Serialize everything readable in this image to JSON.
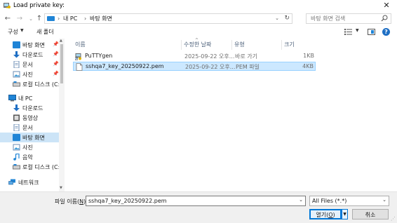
{
  "window": {
    "title": "Load private key:"
  },
  "address": {
    "crumbs": [
      "내 PC",
      "바탕 화면"
    ]
  },
  "search": {
    "placeholder": "바탕 화면 검색"
  },
  "toolbar": {
    "organize": "구성",
    "new_folder": "새 폴더"
  },
  "sidebar": {
    "items": [
      {
        "label": "바탕 화면",
        "icon": "desktop-icon",
        "pinned": true
      },
      {
        "label": "다운로드",
        "icon": "download-icon",
        "pinned": true
      },
      {
        "label": "문서",
        "icon": "document-icon",
        "pinned": true
      },
      {
        "label": "사진",
        "icon": "picture-icon",
        "pinned": true
      },
      {
        "label": "로컬 디스크 (C:)",
        "icon": "drive-icon",
        "pinned": false
      },
      {
        "label": "내 PC",
        "icon": "pc-icon",
        "pinned": false
      },
      {
        "label": "다운로드",
        "icon": "download-icon",
        "pinned": false
      },
      {
        "label": "동영상",
        "icon": "video-icon",
        "pinned": false
      },
      {
        "label": "문서",
        "icon": "document-icon",
        "pinned": false
      },
      {
        "label": "바탕 화면",
        "icon": "desktop-icon",
        "pinned": false,
        "selected": true
      },
      {
        "label": "사진",
        "icon": "picture-icon",
        "pinned": false
      },
      {
        "label": "음악",
        "icon": "music-icon",
        "pinned": false
      },
      {
        "label": "로컬 디스크 (C:)",
        "icon": "drive-icon",
        "pinned": false
      },
      {
        "label": "네트워크",
        "icon": "network-icon",
        "pinned": false
      }
    ]
  },
  "columns": {
    "name": "이름",
    "date": "수정한 날짜",
    "type": "유형",
    "size": "크기"
  },
  "files": [
    {
      "name": "PuTTYgen",
      "date": "2025-09-22 오후...",
      "type": "바로 가기",
      "size": "1KB",
      "icon": "shortcut-icon"
    },
    {
      "name": "sshqa7_key_20250922.pem",
      "date": "2025-09-22 오후...",
      "type": "PEM 파일",
      "size": "4KB",
      "icon": "file-icon",
      "selected": true
    }
  ],
  "bottom": {
    "filename_label_prefix": "파일 이름(",
    "filename_label_key": "N",
    "filename_label_suffix": "):",
    "filename_value": "sshqa7_key_20250922.pem",
    "filetype_value": "All Files (*.*)",
    "open_prefix": "열기(",
    "open_key": "O",
    "open_suffix": ")",
    "cancel": "취소"
  },
  "colors": {
    "accent": "#0078d7",
    "selection": "#cce8ff",
    "folder_blue": "#1f84d6"
  }
}
